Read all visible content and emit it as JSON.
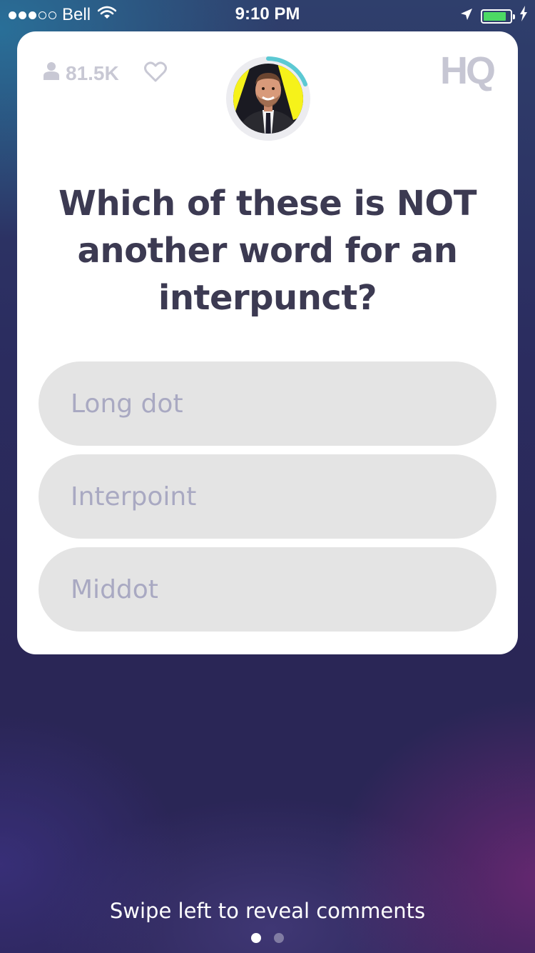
{
  "status_bar": {
    "signal_strength": {
      "filled": 3,
      "total": 5
    },
    "carrier": "Bell",
    "time": "9:10 PM",
    "icons": [
      "wifi-icon",
      "location-arrow-icon",
      "battery-icon",
      "charging-bolt-icon"
    ],
    "battery_level": 0.85,
    "battery_color": "#4cd964"
  },
  "header": {
    "viewer_count": "81.5K",
    "viewer_icon": "person-icon",
    "heart_icon": "heart-icon",
    "logo_text": "HQ",
    "host_avatar": "host-avatar",
    "timer_ring_color": "#5bc9d3"
  },
  "question": {
    "text": "Which of these is NOT another word for an interpunct?"
  },
  "answers": [
    {
      "label": "Long dot"
    },
    {
      "label": "Interpoint"
    },
    {
      "label": "Middot"
    }
  ],
  "footer": {
    "hint": "Swipe left to reveal comments",
    "page_count": 2,
    "active_page": 1
  },
  "colors": {
    "card_background": "#ffffff",
    "answer_background": "#e4e4e4",
    "answer_text": "#a9a9c2",
    "question_text": "#3c3a52"
  }
}
